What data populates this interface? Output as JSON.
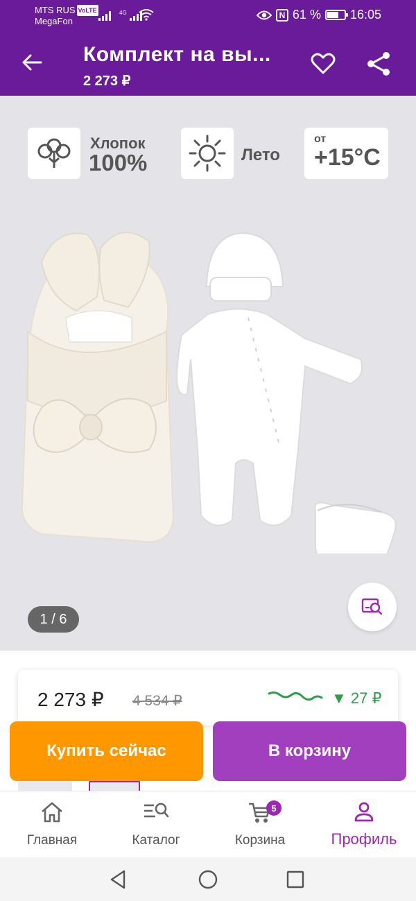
{
  "status_bar": {
    "carrier_primary": "MTS RUS",
    "volte": "VoLTE",
    "carrier_secondary": "MegaFon",
    "signal_tag": "4G",
    "nfc": "N",
    "battery": "61 %",
    "time": "16:05"
  },
  "header": {
    "title": "Комплект на вы...",
    "price": "2 273 ₽"
  },
  "gallery": {
    "badges": {
      "material_line1": "Хлопок",
      "material_line2": "100%",
      "season": "Лето",
      "temp_prefix": "от",
      "temp_value": "+15°C"
    },
    "counter": "1 / 6"
  },
  "pricing": {
    "current": "2 273 ₽",
    "old": "4 534 ₽",
    "drop": "▼ 27 ₽",
    "accent_green": "#2e9c4a"
  },
  "actions": {
    "buy_now": "Купить сейчас",
    "add_to_cart": "В корзину"
  },
  "bottom_nav": {
    "items": [
      {
        "label": "Главная",
        "icon": "home-icon"
      },
      {
        "label": "Каталог",
        "icon": "catalog-search-icon"
      },
      {
        "label": "Корзина",
        "icon": "cart-icon",
        "badge": "5"
      },
      {
        "label": "Профиль",
        "icon": "profile-icon",
        "active": true
      }
    ]
  },
  "colors": {
    "header_purple": "#6a1b9a",
    "buy_orange": "#ff9800",
    "cart_purple": "#a23fbf",
    "active_purple": "#9c27b0"
  }
}
